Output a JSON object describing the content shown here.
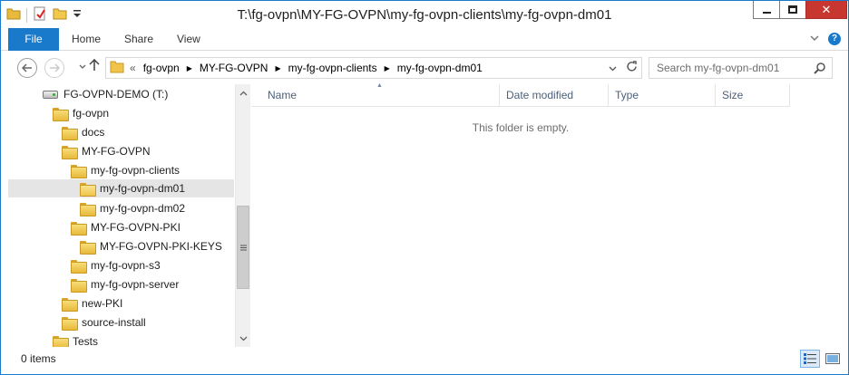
{
  "window": {
    "title": "T:\\fg-ovpn\\MY-FG-OVPN\\my-fg-ovpn-clients\\my-fg-ovpn-dm01",
    "close_glyph": "✕"
  },
  "ribbon": {
    "tabs": [
      {
        "label": "File"
      },
      {
        "label": "Home"
      },
      {
        "label": "Share"
      },
      {
        "label": "View"
      }
    ],
    "help_glyph": "?"
  },
  "address": {
    "overflow_glyph": "«",
    "crumbs": [
      {
        "label": "fg-ovpn"
      },
      {
        "label": "MY-FG-OVPN"
      },
      {
        "label": "my-fg-ovpn-clients"
      },
      {
        "label": "my-fg-ovpn-dm01"
      }
    ]
  },
  "search": {
    "placeholder": "Search my-fg-ovpn-dm01"
  },
  "tree": {
    "items": [
      {
        "label": "FG-OVPN-DEMO (T:)",
        "icon": "drive-icon"
      },
      {
        "label": "fg-ovpn",
        "icon": "folder-icon"
      },
      {
        "label": "docs",
        "icon": "folder-icon"
      },
      {
        "label": "MY-FG-OVPN",
        "icon": "folder-icon"
      },
      {
        "label": "my-fg-ovpn-clients",
        "icon": "folder-icon"
      },
      {
        "label": "my-fg-ovpn-dm01",
        "icon": "folder-icon",
        "selected": true
      },
      {
        "label": "my-fg-ovpn-dm02",
        "icon": "folder-icon"
      },
      {
        "label": "MY-FG-OVPN-PKI",
        "icon": "folder-icon"
      },
      {
        "label": "MY-FG-OVPN-PKI-KEYS",
        "icon": "folder-icon"
      },
      {
        "label": "my-fg-ovpn-s3",
        "icon": "folder-icon"
      },
      {
        "label": "my-fg-ovpn-server",
        "icon": "folder-icon"
      },
      {
        "label": "new-PKI",
        "icon": "folder-icon"
      },
      {
        "label": "source-install",
        "icon": "folder-icon"
      },
      {
        "label": "Tests",
        "icon": "folder-icon"
      }
    ]
  },
  "content": {
    "columns": [
      {
        "label": "Name"
      },
      {
        "label": "Date modified"
      },
      {
        "label": "Type"
      },
      {
        "label": "Size"
      }
    ],
    "empty_message": "This folder is empty."
  },
  "status": {
    "items_text": "0 items"
  },
  "colors": {
    "accent": "#1979ca",
    "close_button": "#c7372f",
    "selection": "#e5e5e5",
    "folder": "#e8b93a"
  }
}
